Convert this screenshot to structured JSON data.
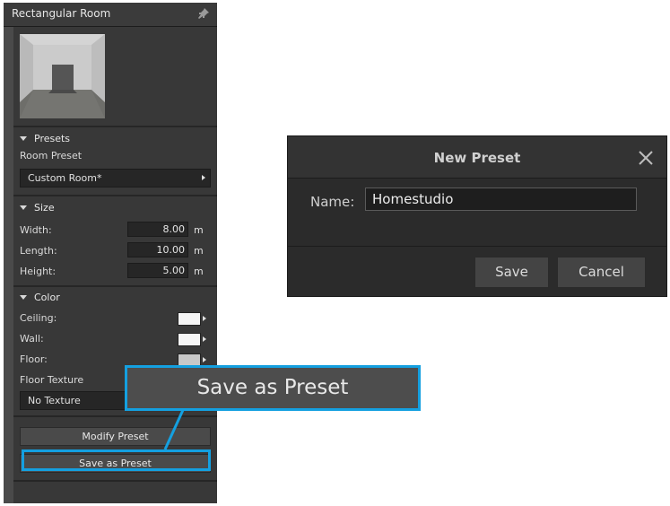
{
  "panel": {
    "title": "Rectangular Room",
    "presets": {
      "header": "Presets",
      "room_preset_label": "Room Preset",
      "room_preset_value": "Custom Room*"
    },
    "size": {
      "header": "Size",
      "width_label": "Width:",
      "width_value": "8.00",
      "length_label": "Length:",
      "length_value": "10.00",
      "height_label": "Height:",
      "height_value": "5.00",
      "unit": "m"
    },
    "color": {
      "header": "Color",
      "ceiling_label": "Ceiling:",
      "wall_label": "Wall:",
      "floor_label": "Floor:",
      "floor_texture_label": "Floor Texture",
      "floor_texture_value": "No Texture",
      "ceiling_color": "#f4f4f4",
      "wall_color": "#f6f6f6",
      "floor_color": "#c8c8c8"
    },
    "modify_preset_label": "Modify Preset",
    "save_as_preset_label": "Save as Preset"
  },
  "callout": {
    "label": "Save as Preset",
    "color": "#14a0e0"
  },
  "dialog": {
    "title": "New Preset",
    "name_label": "Name:",
    "name_value": "Homestudio",
    "save_label": "Save",
    "cancel_label": "Cancel"
  }
}
